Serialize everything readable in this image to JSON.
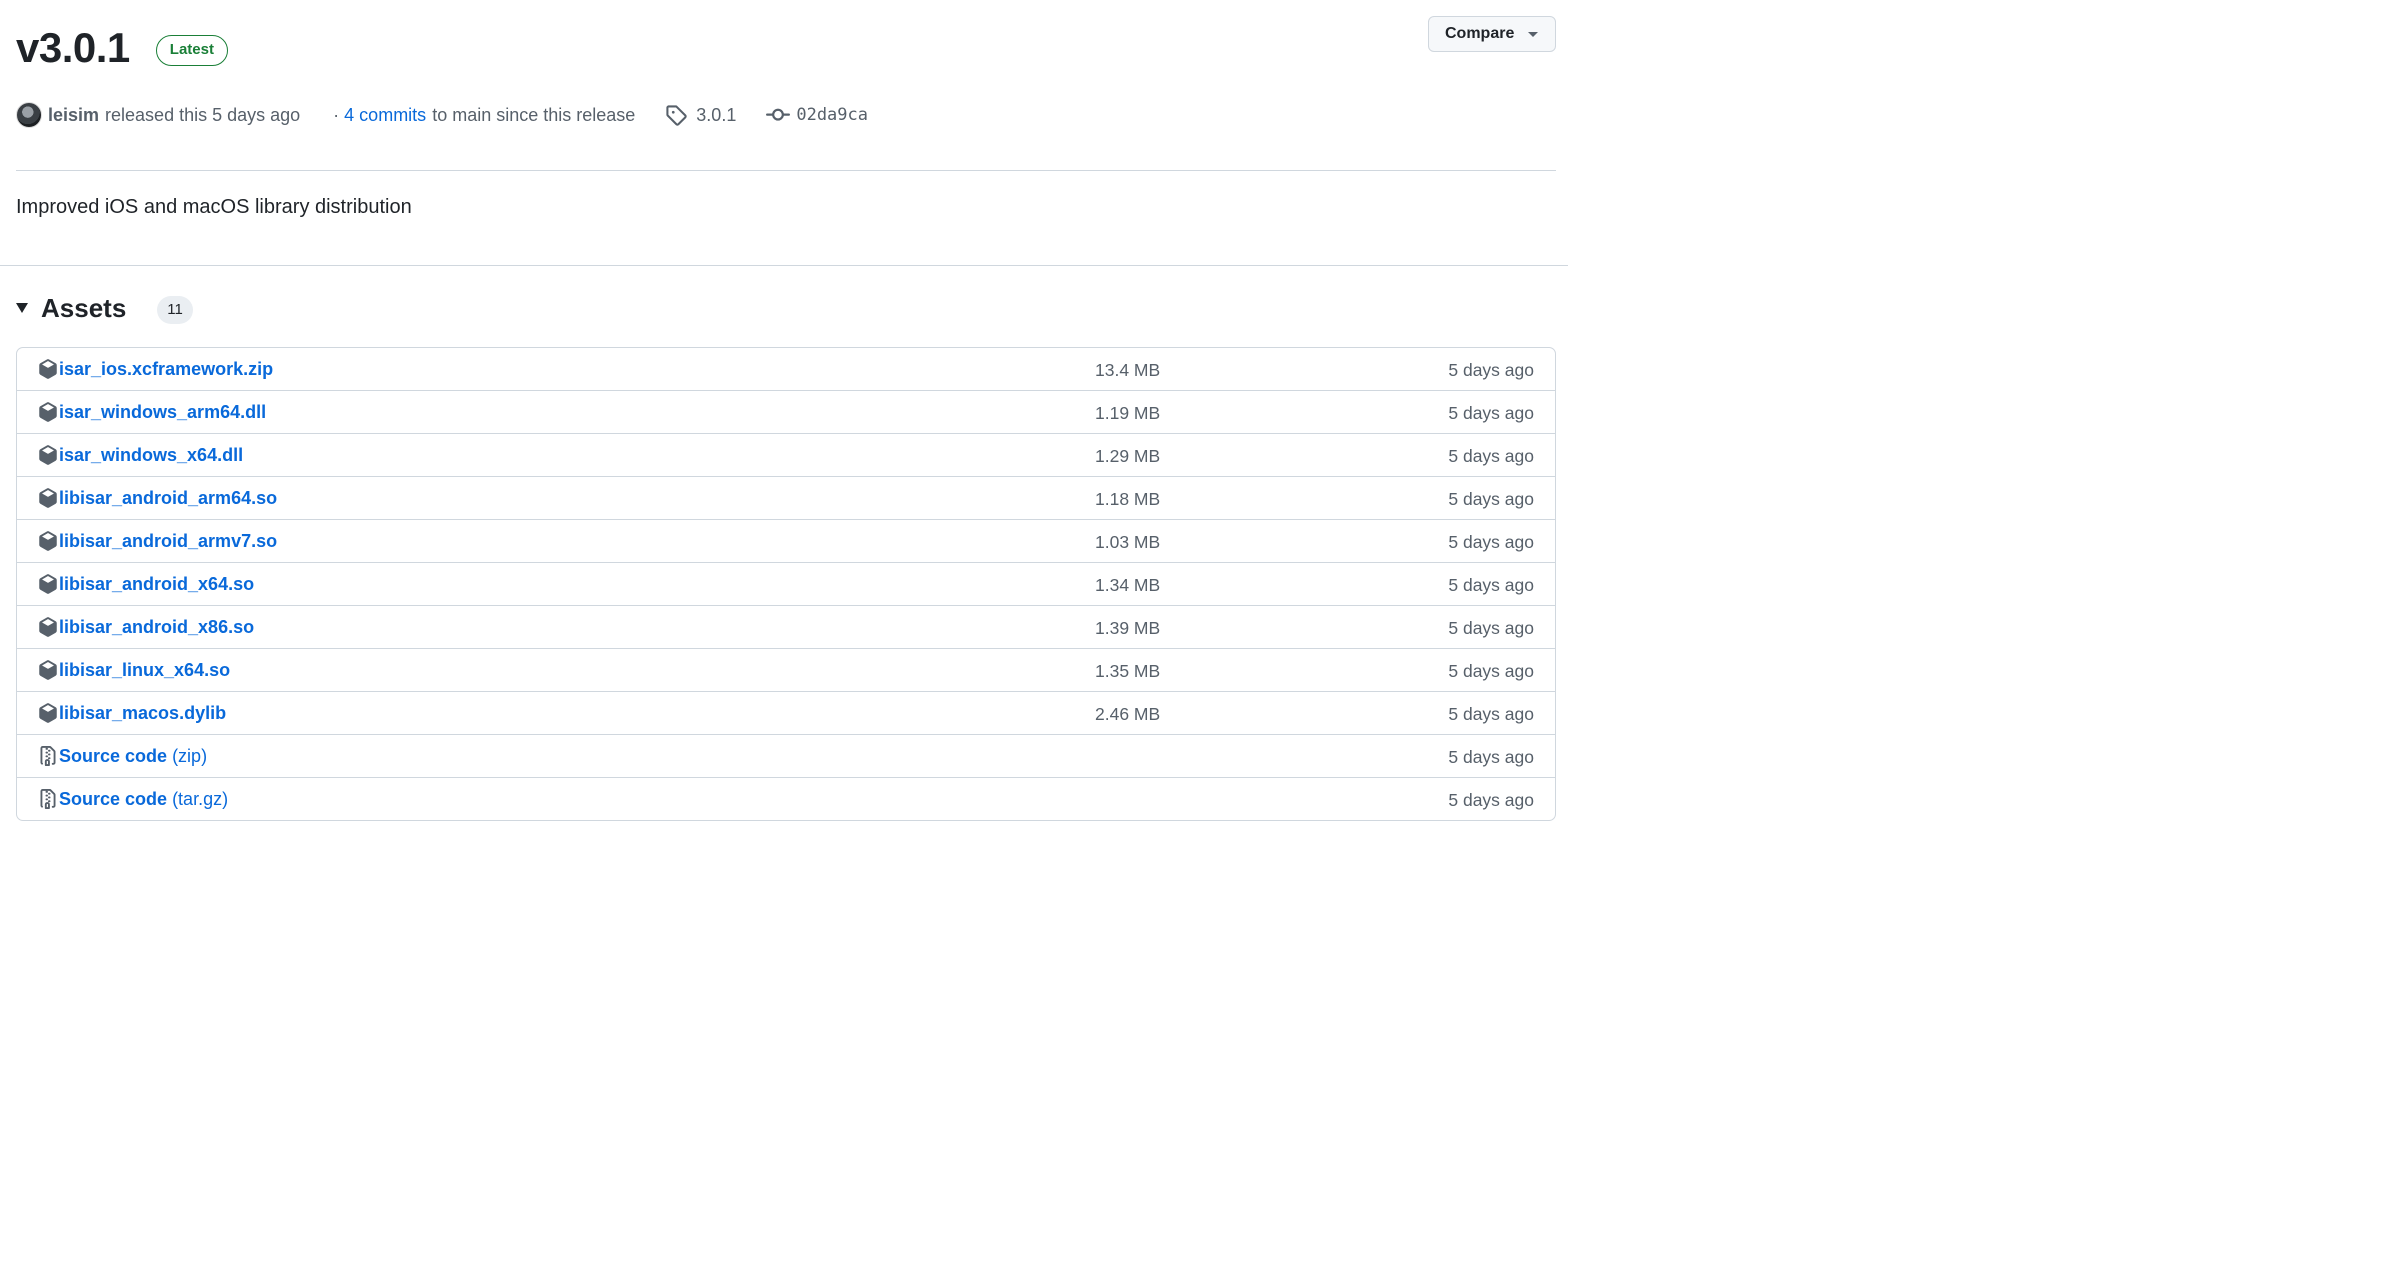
{
  "release": {
    "version": "v3.0.1",
    "badge": "Latest",
    "author": "leisim",
    "released_text": "released this 5 days ago",
    "dot": "·",
    "commits_link": "4 commits",
    "commits_rest": "to main since this release",
    "tag": "3.0.1",
    "commit_sha": "02da9ca",
    "description": "Improved iOS and macOS library distribution"
  },
  "compare_button": {
    "label": "Compare"
  },
  "assets": {
    "title": "Assets",
    "count": "11",
    "items": [
      {
        "name": "isar_ios.xcframework.zip",
        "suffix": "",
        "size": "13.4 MB",
        "date": "5 days ago",
        "icon": "package-icon"
      },
      {
        "name": "isar_windows_arm64.dll",
        "suffix": "",
        "size": "1.19 MB",
        "date": "5 days ago",
        "icon": "package-icon"
      },
      {
        "name": "isar_windows_x64.dll",
        "suffix": "",
        "size": "1.29 MB",
        "date": "5 days ago",
        "icon": "package-icon"
      },
      {
        "name": "libisar_android_arm64.so",
        "suffix": "",
        "size": "1.18 MB",
        "date": "5 days ago",
        "icon": "package-icon"
      },
      {
        "name": "libisar_android_armv7.so",
        "suffix": "",
        "size": "1.03 MB",
        "date": "5 days ago",
        "icon": "package-icon"
      },
      {
        "name": "libisar_android_x64.so",
        "suffix": "",
        "size": "1.34 MB",
        "date": "5 days ago",
        "icon": "package-icon"
      },
      {
        "name": "libisar_android_x86.so",
        "suffix": "",
        "size": "1.39 MB",
        "date": "5 days ago",
        "icon": "package-icon"
      },
      {
        "name": "libisar_linux_x64.so",
        "suffix": "",
        "size": "1.35 MB",
        "date": "5 days ago",
        "icon": "package-icon"
      },
      {
        "name": "libisar_macos.dylib",
        "suffix": "",
        "size": "2.46 MB",
        "date": "5 days ago",
        "icon": "package-icon"
      },
      {
        "name": "Source code",
        "suffix": "(zip)",
        "size": "",
        "date": "5 days ago",
        "icon": "file-zip-icon"
      },
      {
        "name": "Source code",
        "suffix": "(tar.gz)",
        "size": "",
        "date": "5 days ago",
        "icon": "file-zip-icon"
      }
    ]
  },
  "colors": {
    "link": "#0969da",
    "badge_green": "#1a7f37",
    "muted": "#57606a",
    "border": "#d0d7de"
  }
}
